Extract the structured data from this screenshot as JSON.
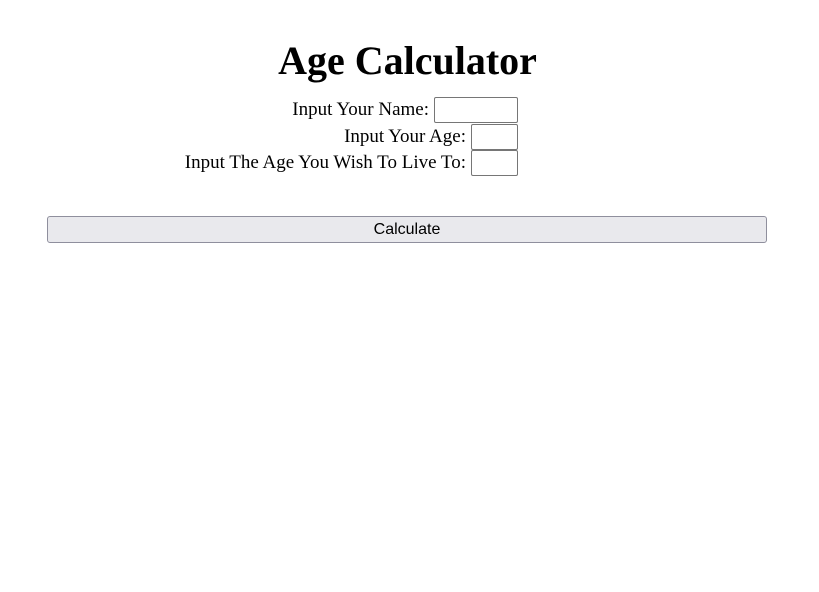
{
  "page": {
    "title": "Age Calculator"
  },
  "form": {
    "name_label": "Input Your Name:",
    "name_value": "",
    "age_label": "Input Your Age:",
    "age_value": "",
    "target_age_label": "Input The Age You Wish To Live To:",
    "target_age_value": ""
  },
  "actions": {
    "calculate_label": "Calculate"
  }
}
